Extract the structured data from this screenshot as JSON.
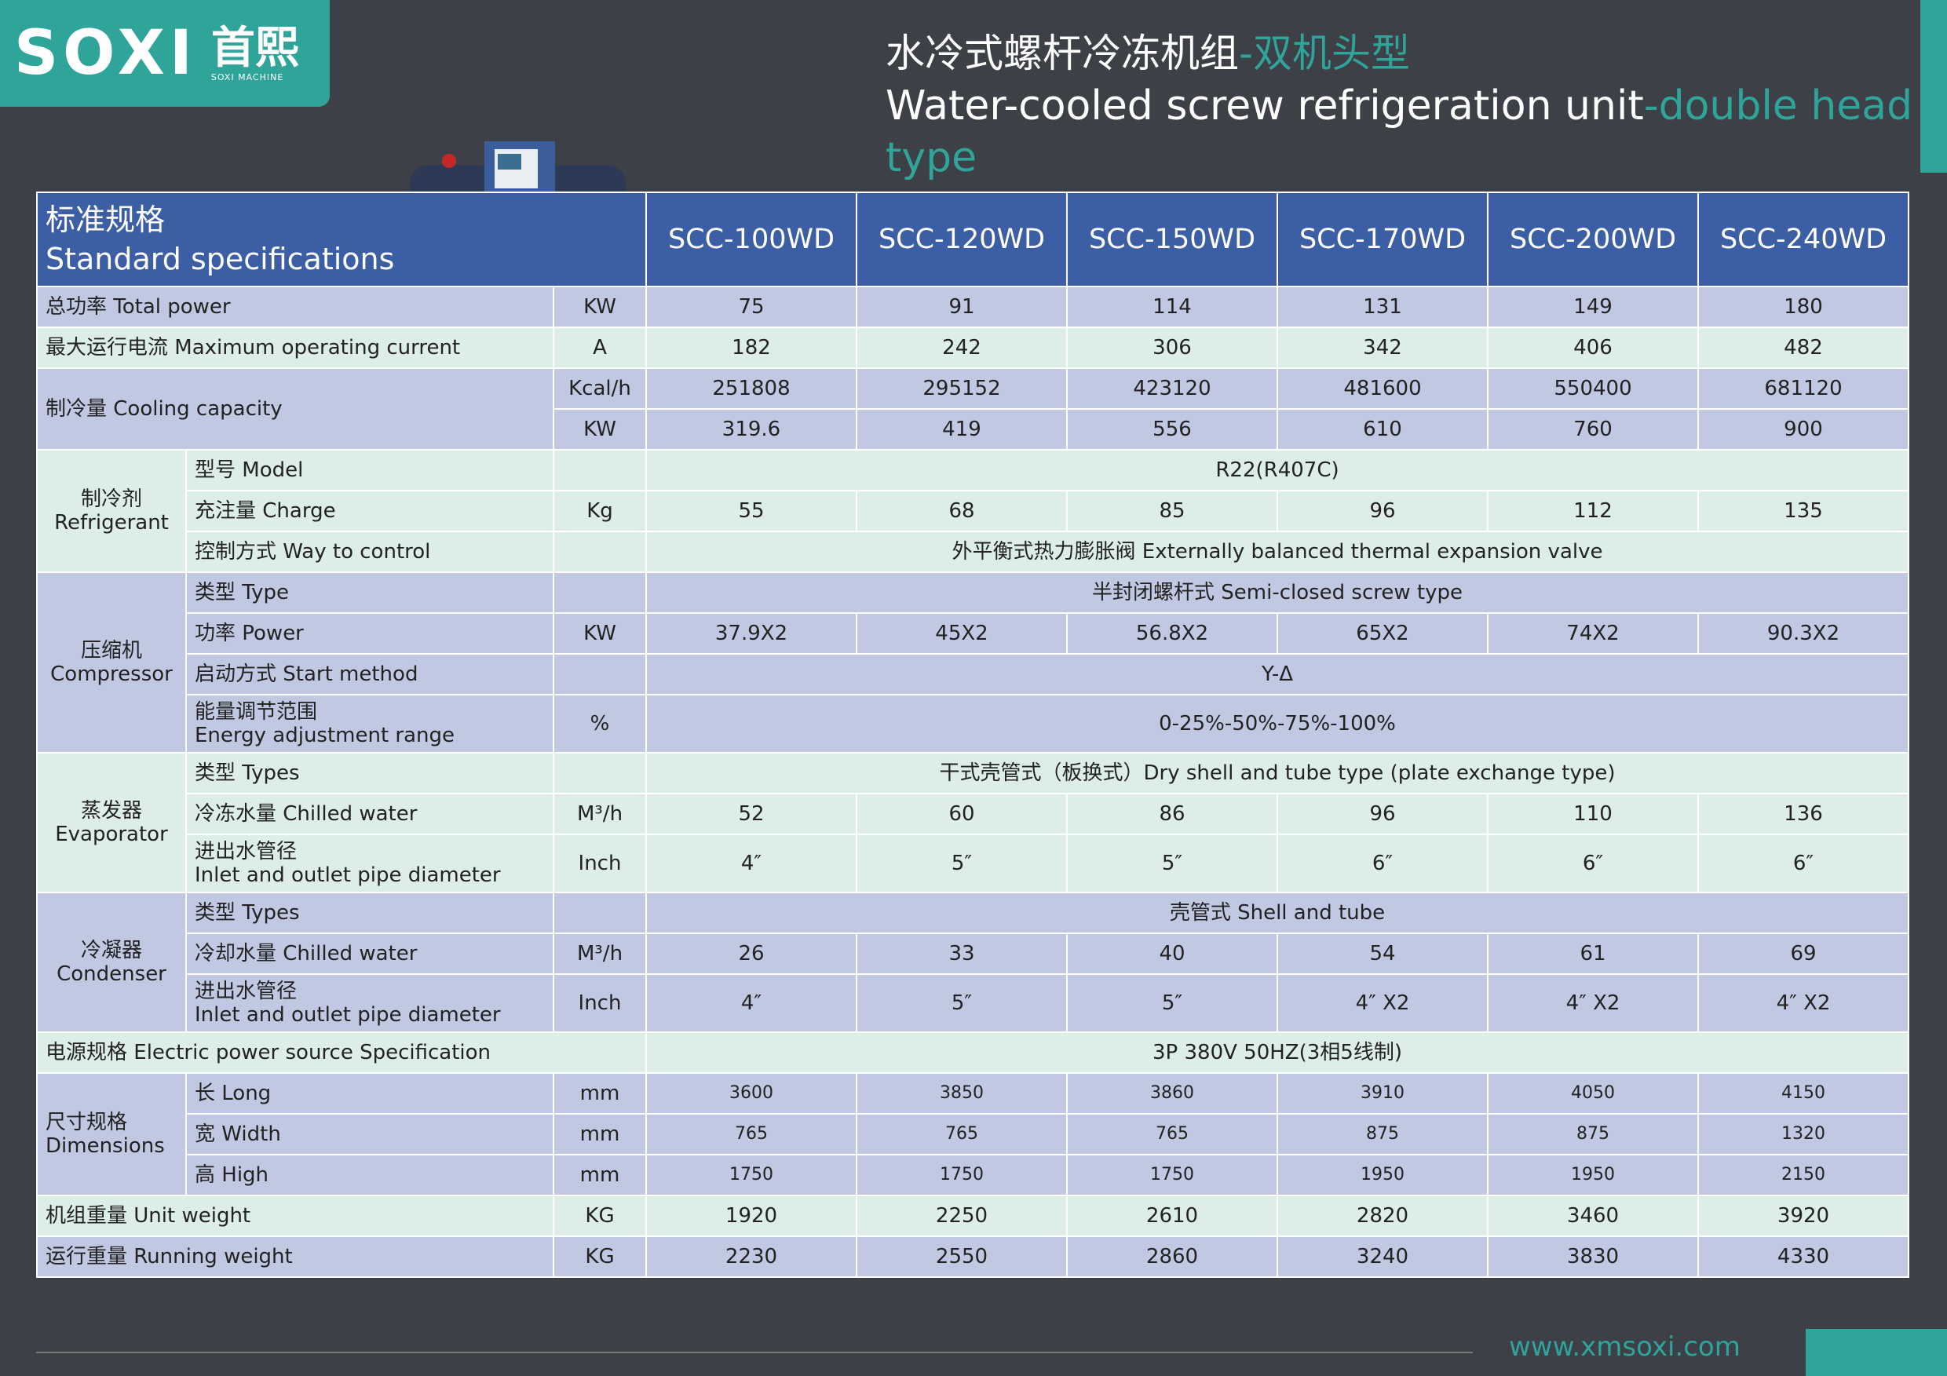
{
  "brand": {
    "logo_word": "SOXI",
    "logo_cn": "首熙",
    "logo_sub": "SOXI MACHINE"
  },
  "title": {
    "cn_main": "水冷式螺杆冷冻机组",
    "cn_accent": "-双机头型",
    "en_main": "Water-cooled screw refrigeration unit",
    "en_accent": "-double head type"
  },
  "header": {
    "cn": "标准规格",
    "en": "Standard specifications",
    "models": [
      "SCC-100WD",
      "SCC-120WD",
      "SCC-150WD",
      "SCC-170WD",
      "SCC-200WD",
      "SCC-240WD"
    ]
  },
  "rows": {
    "total_power": {
      "label": "总功率 Total power",
      "unit": "KW",
      "values": [
        "75",
        "91",
        "114",
        "131",
        "149",
        "180"
      ]
    },
    "max_current": {
      "label": "最大运行电流 Maximum operating current",
      "unit": "A",
      "values": [
        "182",
        "242",
        "306",
        "342",
        "406",
        "482"
      ]
    },
    "cooling": {
      "label": "制冷量 Cooling capacity",
      "unit1": "Kcal/h",
      "values1": [
        "251808",
        "295152",
        "423120",
        "481600",
        "550400",
        "681120"
      ],
      "unit2": "KW",
      "values2": [
        "319.6",
        "419",
        "556",
        "610",
        "760",
        "900"
      ]
    },
    "refrigerant": {
      "group_cn": "制冷剂",
      "group_en": "Refrigerant",
      "model_label": "型号 Model",
      "model_value": "R22(R407C)",
      "charge_label": "充注量 Charge",
      "charge_unit": "Kg",
      "charge_values": [
        "55",
        "68",
        "85",
        "96",
        "112",
        "135"
      ],
      "control_label": "控制方式 Way to control",
      "control_value": "外平衡式热力膨胀阀 Externally balanced thermal expansion valve"
    },
    "compressor": {
      "group_cn": "压缩机",
      "group_en": "Compressor",
      "type_label": "类型 Type",
      "type_value": "半封闭螺杆式 Semi-closed screw type",
      "power_label": "功率 Power",
      "power_unit": "KW",
      "power_values": [
        "37.9X2",
        "45X2",
        "56.8X2",
        "65X2",
        "74X2",
        "90.3X2"
      ],
      "start_label": "启动方式 Start method",
      "start_value": "Y-Δ",
      "energy_label_cn": "能量调节范围",
      "energy_label_en": "Energy adjustment range",
      "energy_unit": "%",
      "energy_value": "0-25%-50%-75%-100%"
    },
    "evaporator": {
      "group_cn": "蒸发器",
      "group_en": "Evaporator",
      "type_label": "类型 Types",
      "type_value": "干式壳管式（板换式）Dry shell and tube type (plate exchange type)",
      "water_label": "冷冻水量 Chilled water",
      "water_unit": "M³/h",
      "water_values": [
        "52",
        "60",
        "86",
        "96",
        "110",
        "136"
      ],
      "pipe_label_cn": "进出水管径",
      "pipe_label_en": "Inlet and outlet pipe diameter",
      "pipe_unit": "Inch",
      "pipe_values": [
        "4″",
        "5″",
        "5″",
        "6″",
        "6″",
        "6″"
      ]
    },
    "condenser": {
      "group_cn": "冷凝器",
      "group_en": "Condenser",
      "type_label": "类型 Types",
      "type_value": "壳管式 Shell and tube",
      "water_label": "冷却水量 Chilled water",
      "water_unit": "M³/h",
      "water_values": [
        "26",
        "33",
        "40",
        "54",
        "61",
        "69"
      ],
      "pipe_label_cn": "进出水管径",
      "pipe_label_en": "Inlet and outlet pipe diameter",
      "pipe_unit": "Inch",
      "pipe_values": [
        "4″",
        "5″",
        "5″",
        "4″ X2",
        "4″ X2",
        "4″ X2"
      ]
    },
    "power_source": {
      "label": "电源规格 Electric power source Specification",
      "value": "3P 380V 50HZ(3相5线制)"
    },
    "dimensions": {
      "group_cn": "尺寸规格",
      "group_en": "Dimensions",
      "long_label": "长 Long",
      "long_unit": "mm",
      "long_values": [
        "3600",
        "3850",
        "3860",
        "3910",
        "4050",
        "4150"
      ],
      "width_label": "宽 Width",
      "width_unit": "mm",
      "width_values": [
        "765",
        "765",
        "765",
        "875",
        "875",
        "1320"
      ],
      "high_label": "高 High",
      "high_unit": "mm",
      "high_values": [
        "1750",
        "1750",
        "1750",
        "1950",
        "1950",
        "2150"
      ]
    },
    "unit_weight": {
      "label": "机组重量 Unit weight",
      "unit": "KG",
      "values": [
        "1920",
        "2250",
        "2610",
        "2820",
        "3460",
        "3920"
      ]
    },
    "running_weight": {
      "label": "运行重量 Running weight",
      "unit": "KG",
      "values": [
        "2230",
        "2550",
        "2860",
        "3240",
        "3830",
        "4330"
      ]
    }
  },
  "footer": {
    "url": "www.xmsoxi.com"
  },
  "colors": {
    "accent": "#2fa59a",
    "header_blue": "#3b5ea5",
    "row_blue": "#c0c8e2",
    "row_green": "#dceee5",
    "background": "#3d4046"
  }
}
